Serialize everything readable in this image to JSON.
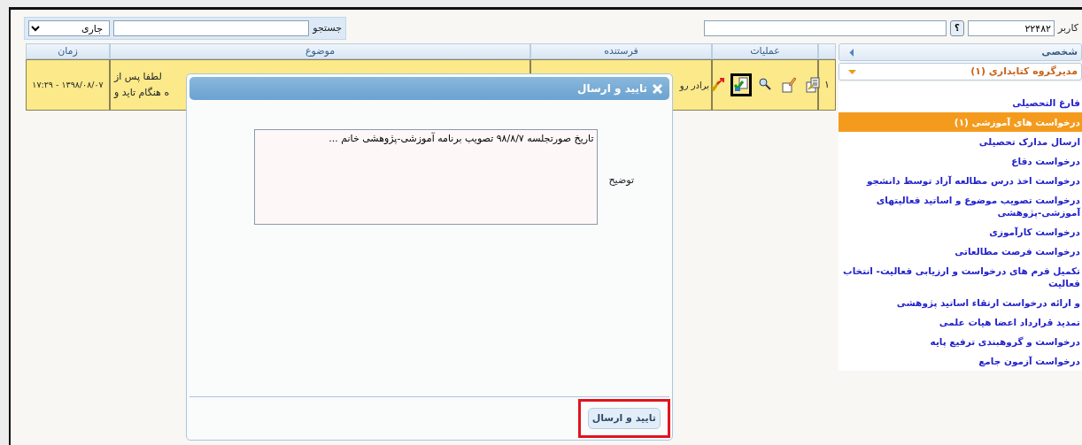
{
  "user_bar": {
    "label": "کاربر",
    "user_id": "۲۲۴۸۲",
    "help": "؟"
  },
  "search": {
    "label": "جستجو",
    "filter": "جاری"
  },
  "table": {
    "columns": [
      {
        "label": "عملیات"
      },
      {
        "label": "فرستنده"
      },
      {
        "label": "موضوع"
      },
      {
        "label": "زمان"
      }
    ],
    "rows": [
      {
        "number": "۱",
        "time": "۱۳۹۸/۰۸/۰۷ - ۱۷:۲۹",
        "subject_lines": [
          "لطفا پس از",
          "ه هنگام تاید و"
        ],
        "sender": "برادر رو",
        "selected": true,
        "actions": [
          {
            "kind": "report",
            "marked": false
          },
          {
            "kind": "edit",
            "marked": false
          },
          {
            "kind": "search",
            "marked": false
          },
          {
            "kind": "send",
            "marked": true
          },
          {
            "kind": "approve",
            "marked": false
          }
        ]
      }
    ]
  },
  "sidebar": {
    "panels": [
      {
        "title": "شخصی",
        "expanded": false
      },
      {
        "title": "مدیرگروه کتابداری (۱)",
        "expanded": true,
        "items": [
          {
            "label": "فارغ التحصیلی",
            "selected": false
          },
          {
            "label": "درخواست های آموزشی (۱)",
            "selected": true
          },
          {
            "label": "ارسال مدارک تحصیلی",
            "selected": false
          },
          {
            "label": "درخواست دفاع",
            "selected": false
          },
          {
            "label": "درخواست اخذ درس مطالعه آزاد توسط دانشجو",
            "selected": false
          },
          {
            "label": "درخواست تصویب موضوع و اساتید فعالیتهای آموزشی-پژوهشی",
            "selected": false
          },
          {
            "label": "درخواست کارآموزی",
            "selected": false
          },
          {
            "label": "درخواست فرصت مطالعاتی",
            "selected": false
          },
          {
            "label": "تکمیل فرم های درخواست و ارزیابی فعالیت- انتخاب فعالیت",
            "selected": false
          },
          {
            "label": "و ارائه درخواست ارتقاء اساتید پژوهشی",
            "selected": false
          },
          {
            "label": "تمدید قرارداد اعضا هیات علمی",
            "selected": false
          },
          {
            "label": "درخواست و گروهبندی ترفیع پایه",
            "selected": false
          },
          {
            "label": "درخواست آزمون جامع",
            "selected": false
          }
        ]
      }
    ]
  },
  "dialog": {
    "title": "تایید و ارسال",
    "field_label": "توضیح",
    "field_value": "تاریخ صورتجلسه ۹۸/۸/۷ تصویب برنامه آموزشی-پژوهشی خانم ...",
    "button": {
      "label": "تایید و ارسال",
      "highlighted": true
    }
  }
}
